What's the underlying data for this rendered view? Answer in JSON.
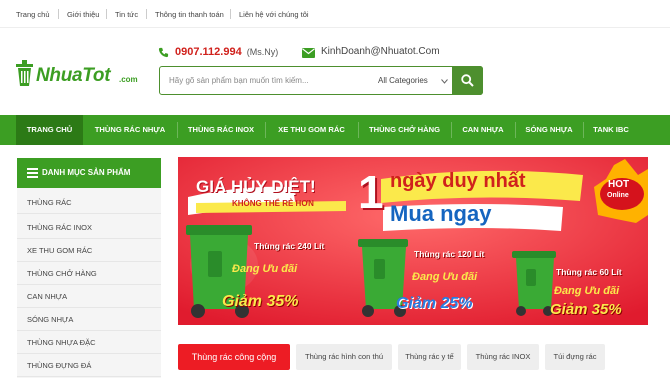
{
  "topbar": {
    "links": [
      "Trang chủ",
      "Giới thiệu",
      "Tin tức",
      "Thông tin thanh toán",
      "Liên hệ với chúng tôi"
    ]
  },
  "header": {
    "logo_text": "NhuaTot",
    "logo_suffix": ".com",
    "phone": "0907.112.994",
    "phone_note": "(Ms.Ny)",
    "email": "KinhDoanh@Nhuatot.Com"
  },
  "search": {
    "placeholder": "Hãy gõ sản phẩm bạn muốn tìm kiếm...",
    "category": "All Categories"
  },
  "nav": {
    "items": [
      "TRANG CHỦ",
      "THÙNG RÁC NHỰA",
      "THÙNG RÁC INOX",
      "XE THU GOM RÁC",
      "THÙNG CHỞ HÀNG",
      "CAN NHỰA",
      "SÓNG NHỰA",
      "TANK IBC"
    ]
  },
  "sidebar": {
    "title": "DANH MỤC SẢN PHẨM",
    "items": [
      "THÙNG RÁC",
      "THÙNG RÁC INOX",
      "XE THU GOM RÁC",
      "THÙNG CHỞ HÀNG",
      "CAN NHỰA",
      "SÓNG NHỰA",
      "THÙNG NHỰA ĐẶC",
      "THÙNG ĐỰNG ĐÁ"
    ]
  },
  "banner": {
    "headline_left": "GIÁ HỦY DIỆT!",
    "sub_left": "KHÔNG THỂ RẺ HƠN",
    "big_number": "1",
    "headline_right": "ngày duy nhất",
    "cta": "Mua ngay",
    "hot_badge": "HOT",
    "hot_sub": "Online",
    "products": [
      {
        "label": "Thùng rác 240 Lít",
        "promo": "Đang Ưu đãi",
        "discount": "Giảm 35%"
      },
      {
        "label": "Thùng rác 120 Lít",
        "promo": "Đang Ưu đãi",
        "discount": "Giảm 25%"
      },
      {
        "label": "Thùng rác 60 Lít",
        "promo": "Đang Ưu đãi",
        "discount": "Giảm 35%"
      }
    ]
  },
  "tabs": [
    "Thùng rác công cộng",
    "Thùng rác hình con thú",
    "Thùng rác y tế",
    "Thùng rác INOX",
    "Túi đựng rác"
  ],
  "colors": {
    "brand_green": "#3c9e23",
    "accent_red": "#ed1c24",
    "phone_red": "#d0211c"
  },
  "icons": [
    "phone-icon",
    "email-icon",
    "search-icon",
    "menu-icon",
    "chevron-down-icon"
  ]
}
